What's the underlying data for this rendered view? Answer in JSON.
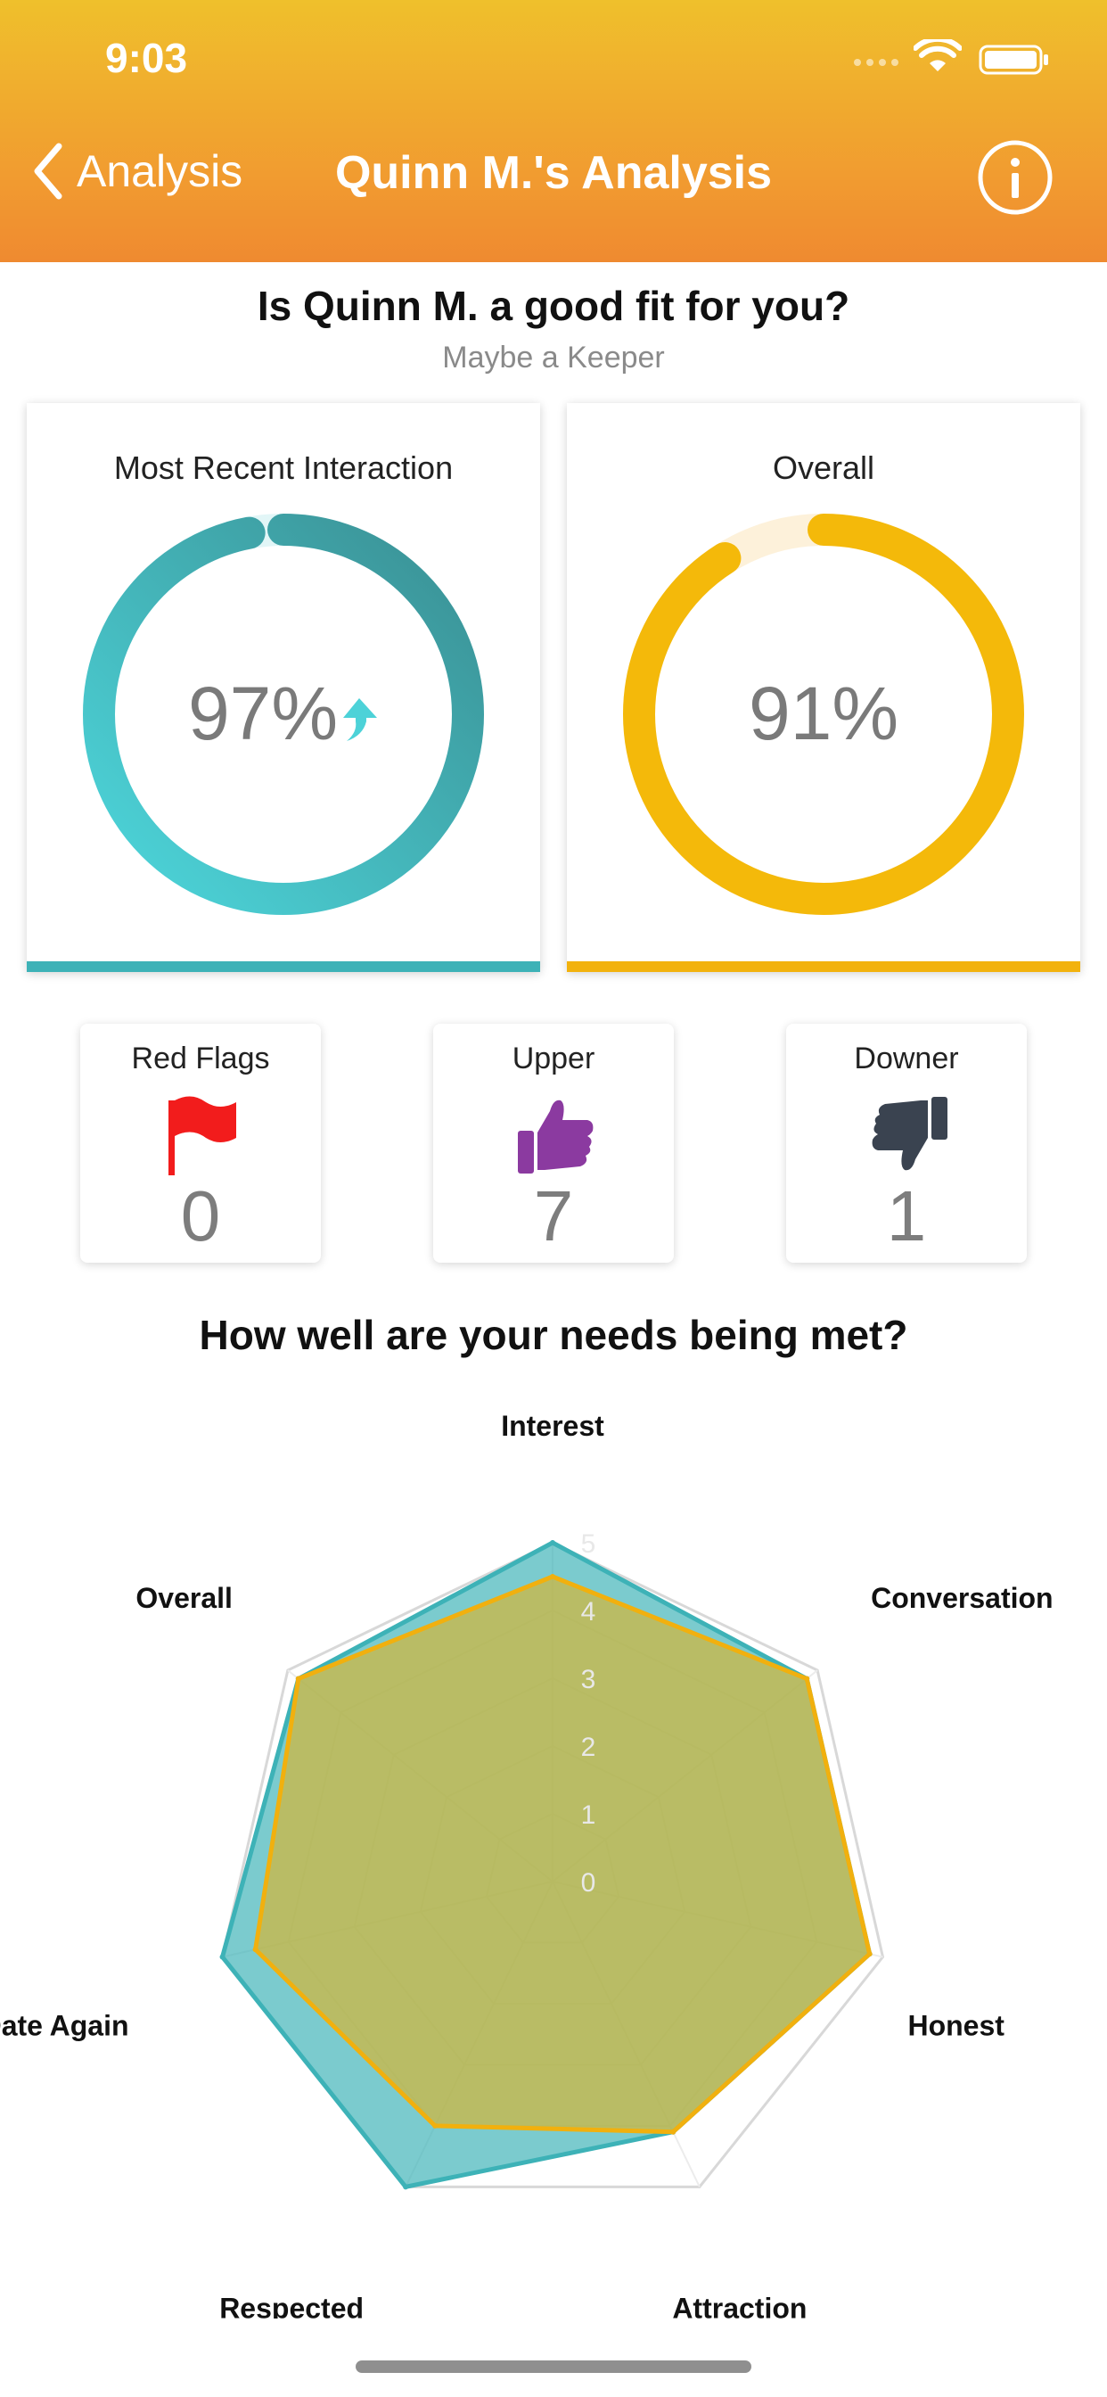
{
  "status_bar": {
    "time": "9:03"
  },
  "nav": {
    "back_label": "Analysis",
    "title": "Quinn M.'s Analysis"
  },
  "header": {
    "question": "Is Quinn M. a good fit for you?",
    "subtitle": "Maybe a Keeper"
  },
  "cards": {
    "recent": {
      "title": "Most Recent Interaction",
      "percent": 97,
      "percent_label": "97%",
      "trend": "up",
      "color_start": "#4dd7dc",
      "color_end": "#3a8f93"
    },
    "overall": {
      "title": "Overall",
      "percent": 91,
      "percent_label": "91%",
      "color_start": "#f5c400",
      "color_end": "#f2b20d"
    }
  },
  "stats": [
    {
      "label": "Red Flags",
      "value": "0",
      "icon": "red-flag-icon",
      "color": "#f21c1c"
    },
    {
      "label": "Upper",
      "value": "7",
      "icon": "thumbs-up-icon",
      "color": "#8b3aa0"
    },
    {
      "label": "Downer",
      "value": "1",
      "icon": "thumbs-down-icon",
      "color": "#3a4350"
    }
  ],
  "needs_title": "How well are your needs being met?",
  "chart_data": {
    "type": "radar",
    "axes": [
      "Interest",
      "Conversation",
      "Honest",
      "Attraction",
      "Respected",
      "Date Again",
      "Overall"
    ],
    "ticks": [
      "0",
      "1",
      "2",
      "3",
      "4",
      "5"
    ],
    "range": [
      0,
      5
    ],
    "series": [
      {
        "values": [
          5,
          4.8,
          4.8,
          4.1,
          5,
          5,
          4.8
        ],
        "color": "#3db2b7"
      },
      {
        "values": [
          4.5,
          4.8,
          4.8,
          4.1,
          4,
          4.5,
          4.8
        ],
        "color": "#f1b00e"
      }
    ]
  }
}
